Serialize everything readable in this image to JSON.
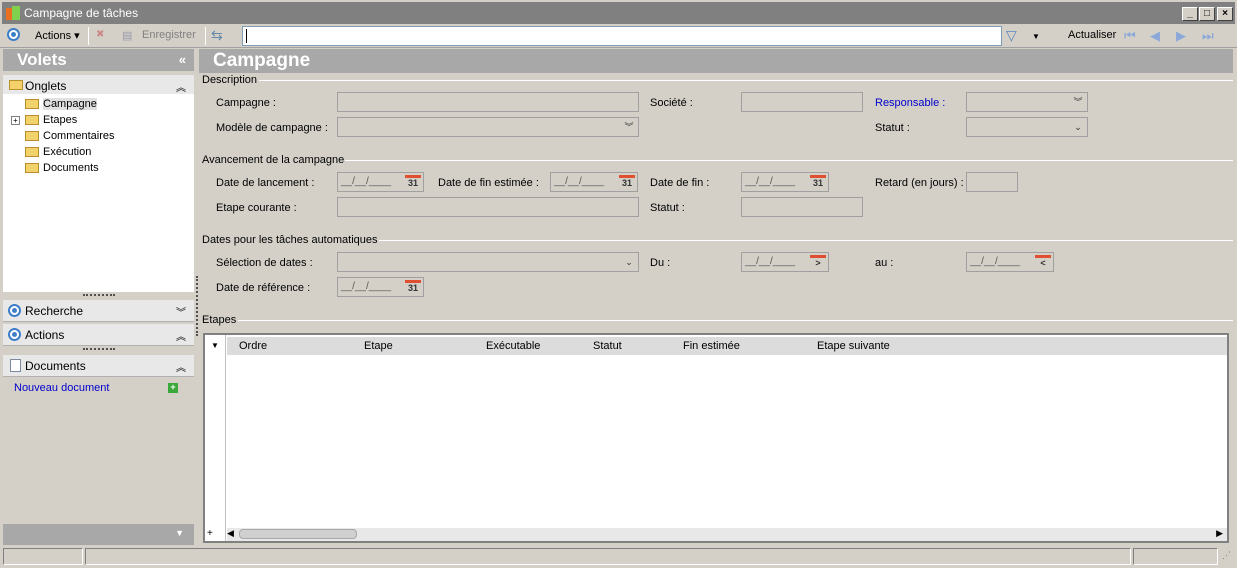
{
  "window": {
    "title": "Campagne de tâches"
  },
  "toolbar": {
    "actions": "Actions",
    "save": "Enregistrer",
    "refresh": "Actualiser",
    "filter_value": ""
  },
  "sidebar": {
    "title": "Volets",
    "onglets": "Onglets",
    "tree": [
      "Campagne",
      "Etapes",
      "Commentaires",
      "Exécution",
      "Documents"
    ],
    "recherche": "Recherche",
    "actions": "Actions",
    "documents": "Documents",
    "new_document": "Nouveau document"
  },
  "main": {
    "title": "Campagne",
    "description": {
      "label": "Description",
      "campagne": "Campagne :",
      "societe": "Société :",
      "responsable": "Responsable :",
      "modele": "Modèle de campagne :",
      "statut": "Statut :"
    },
    "avancement": {
      "label": "Avancement de la campagne",
      "date_lancement": "Date de lancement :",
      "date_fin_estimee": "Date de fin estimée :",
      "date_fin": "Date de fin :",
      "retard": "Retard (en jours) :",
      "etape_courante": "Etape courante :",
      "statut": "Statut :",
      "date_placeholder": "__/__/____"
    },
    "dates_auto": {
      "label": "Dates pour les tâches automatiques",
      "selection": "Sélection de dates :",
      "du": "Du :",
      "au": "au :",
      "reference": "Date de référence :"
    },
    "etapes": {
      "label": "Etapes",
      "columns": [
        "Ordre",
        "Etape",
        "Exécutable",
        "Statut",
        "Fin estimée",
        "Etape suivante"
      ]
    }
  }
}
